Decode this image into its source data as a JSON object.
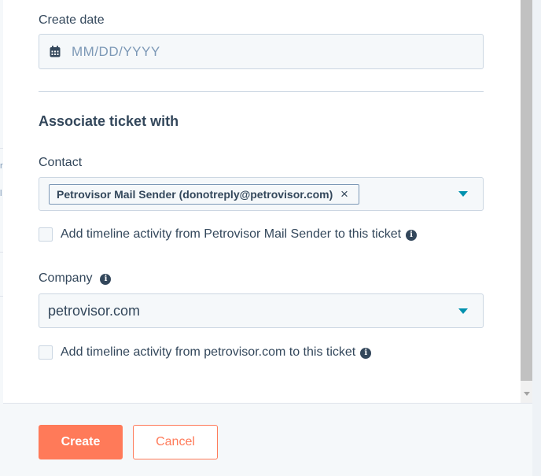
{
  "background_page": {
    "fragments": [
      "r",
      "l"
    ]
  },
  "form": {
    "create_date": {
      "label": "Create date",
      "placeholder": "MM/DD/YYYY",
      "icon": "calendar-icon"
    },
    "associate_section_title": "Associate ticket with",
    "contact": {
      "label": "Contact",
      "selected_tag": "Petrovisor Mail Sender (donotreply@petrovisor.com)",
      "remove_glyph": "×",
      "timeline_checkbox_label": "Add timeline activity from Petrovisor Mail Sender to this ticket",
      "timeline_checked": false
    },
    "company": {
      "label": "Company",
      "value": "petrovisor.com",
      "timeline_checkbox_label": "Add timeline activity from petrovisor.com to this ticket",
      "timeline_checked": false
    },
    "info_glyph": "i"
  },
  "footer": {
    "create_label": "Create",
    "cancel_label": "Cancel"
  },
  "colors": {
    "accent": "#ff7a59",
    "caret": "#0091ae",
    "text": "#33475b",
    "placeholder": "#7c98b6",
    "input_bg": "#f5f8fa",
    "border": "#cbd6e2"
  }
}
